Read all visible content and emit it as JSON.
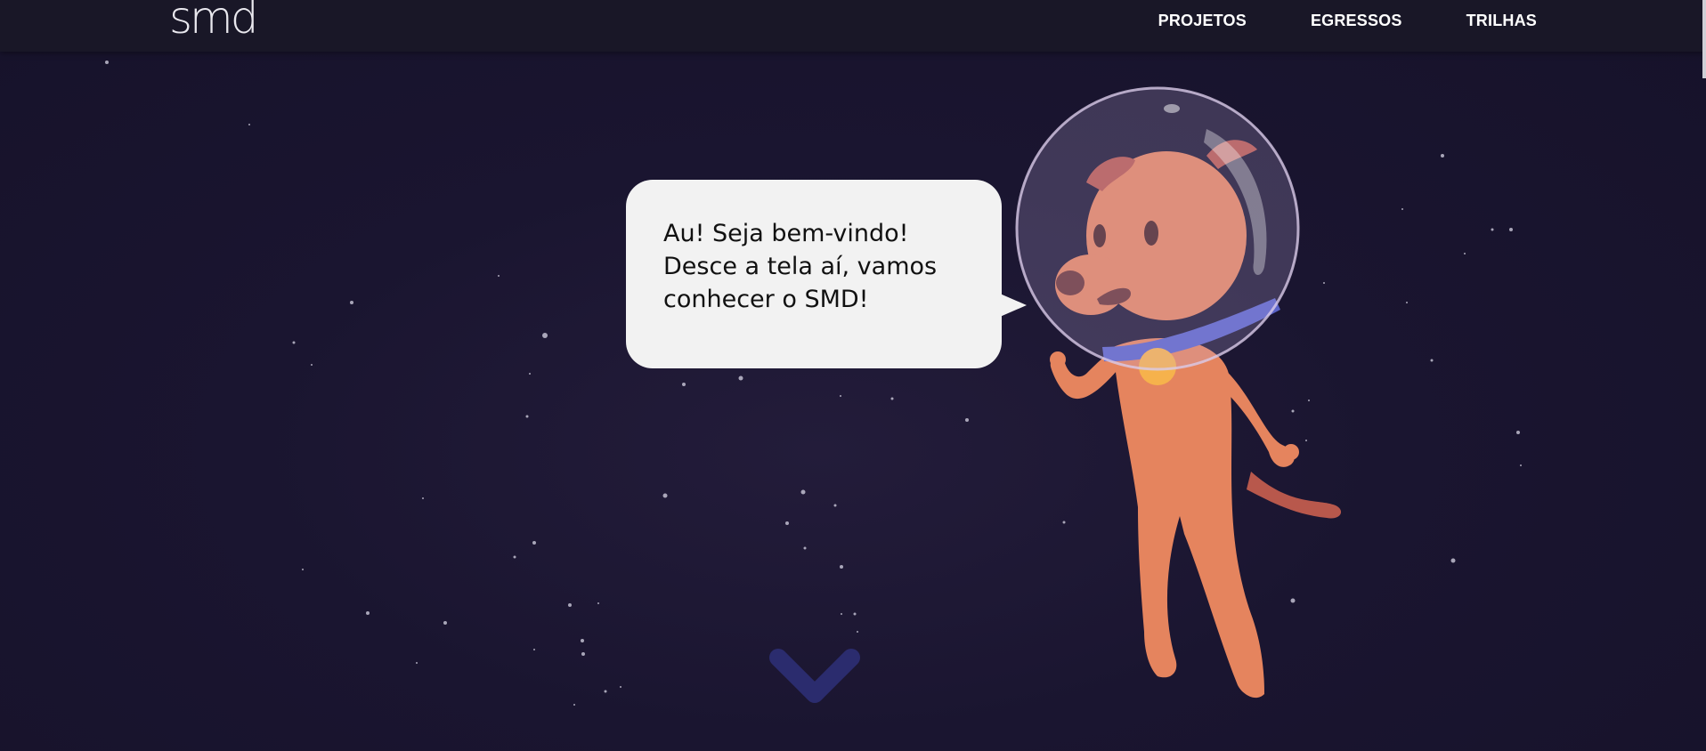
{
  "header": {
    "logo_text": "smd",
    "nav": [
      {
        "label": "PROJETOS"
      },
      {
        "label": "EGRESSOS"
      },
      {
        "label": "TRILHAS"
      }
    ]
  },
  "hero": {
    "speech": "Au! Seja bem-vindo!\nDesce a tela aí, vamos\nconhecer o SMD!",
    "mascot_icon": "astronaut-dog-illustration",
    "scroll_icon": "chevron-down-icon"
  },
  "colors": {
    "background": "#1a1530",
    "navbar": "#191727",
    "bubble": "#f2f2f2",
    "dog": "#e5845e",
    "collar": "#5a63c8",
    "tag": "#f6b24c",
    "chevron": "#2b2c6e"
  }
}
